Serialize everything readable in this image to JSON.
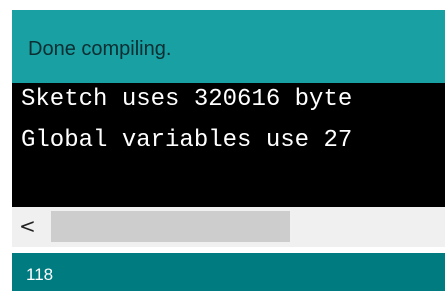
{
  "status": {
    "message": "Done compiling."
  },
  "console": {
    "lines": [
      "Sketch uses 320616 byte",
      "Global variables use 27"
    ]
  },
  "scrollbar": {
    "left_arrow": "<"
  },
  "footer": {
    "line_number": "118"
  },
  "colors": {
    "status_bar": "#19a0a3",
    "console_background": "#000000",
    "console_text": "#ffffff",
    "footer_bar": "#007c80"
  }
}
